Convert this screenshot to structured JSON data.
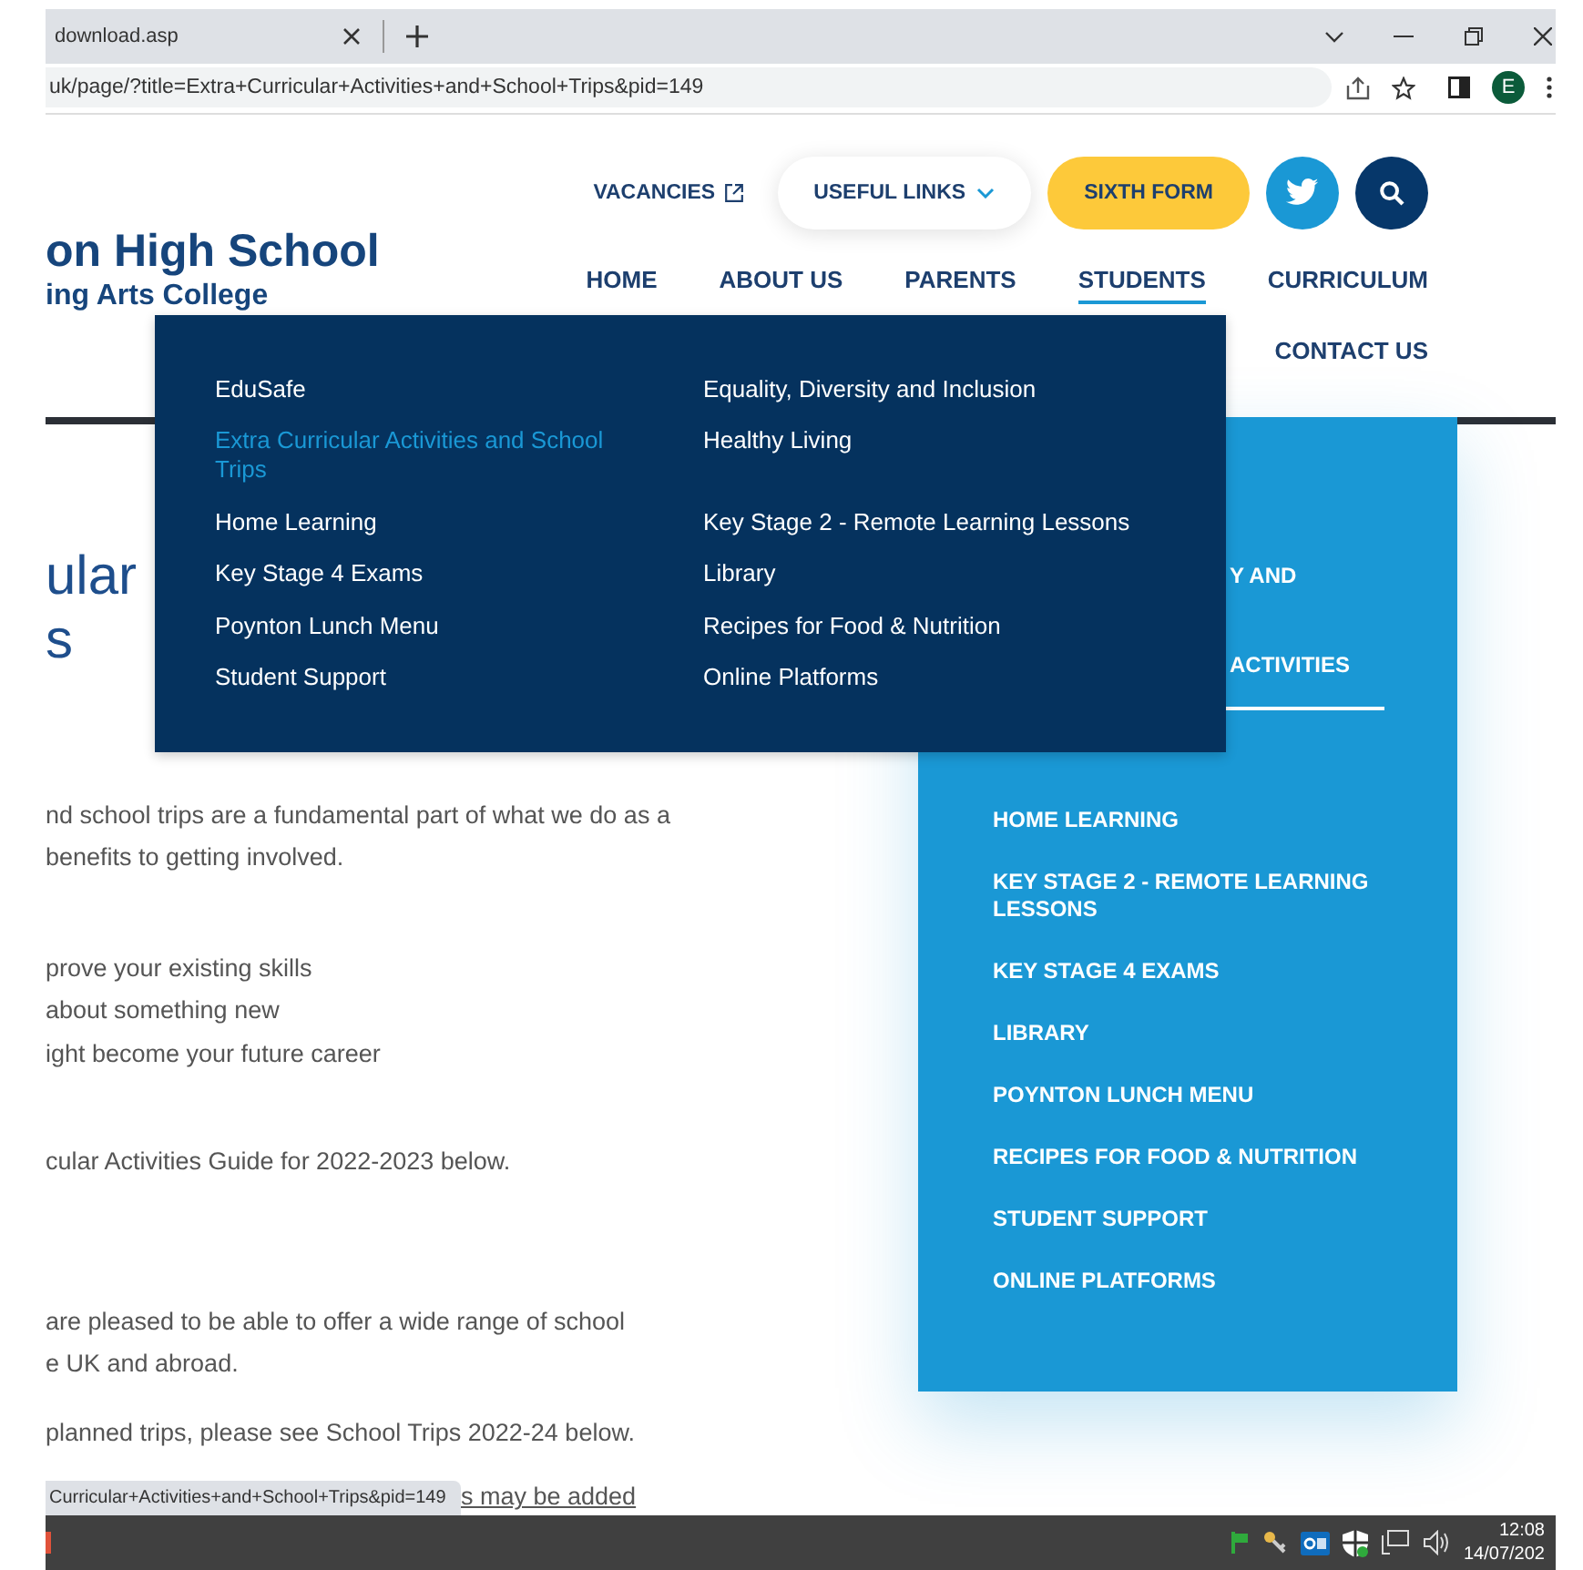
{
  "browser": {
    "tab_title": "download.asp",
    "address": "uk/page/?title=Extra+Curricular+Activities+and+School+Trips&pid=149",
    "profile_initial": "E"
  },
  "header": {
    "logo_line1": "on High School",
    "logo_line2": "ing Arts College",
    "vacancies": "VACANCIES",
    "useful_links": "USEFUL LINKS",
    "sixth_form": "SIXTH FORM",
    "nav": [
      {
        "label": "HOME",
        "selected": false
      },
      {
        "label": "ABOUT US",
        "selected": false
      },
      {
        "label": "PARENTS",
        "selected": false
      },
      {
        "label": "STUDENTS",
        "selected": true
      },
      {
        "label": "CURRICULUM",
        "selected": false
      },
      {
        "label": "CONTACT US",
        "selected": false
      }
    ]
  },
  "dropdown": {
    "left": [
      {
        "label": "EduSafe",
        "selected": false
      },
      {
        "label": "Extra Curricular Activities and School Trips",
        "selected": true
      },
      {
        "label": "Home Learning",
        "selected": false
      },
      {
        "label": "Key Stage 4 Exams",
        "selected": false
      },
      {
        "label": "Poynton Lunch Menu",
        "selected": false
      },
      {
        "label": "Student Support",
        "selected": false
      }
    ],
    "right": [
      {
        "label": "Equality, Diversity and Inclusion",
        "selected": false
      },
      {
        "label": "Healthy Living",
        "selected": false
      },
      {
        "label": "Key Stage 2 - Remote Learning Lessons",
        "selected": false
      },
      {
        "label": "Library",
        "selected": false
      },
      {
        "label": "Recipes for Food & Nutrition",
        "selected": false
      },
      {
        "label": "Online Platforms",
        "selected": false
      }
    ]
  },
  "sidebar": {
    "items": [
      {
        "label": "Y AND",
        "kind": "covered",
        "selected": false
      },
      {
        "label": "ACTIVITIES",
        "kind": "covered",
        "selected": true
      },
      {
        "label": "HOME LEARNING",
        "kind": "full",
        "selected": false
      },
      {
        "label": "KEY STAGE 2 - REMOTE LEARNING LESSONS",
        "kind": "full",
        "selected": false
      },
      {
        "label": "KEY STAGE 4 EXAMS",
        "kind": "full",
        "selected": false
      },
      {
        "label": "LIBRARY",
        "kind": "full",
        "selected": false
      },
      {
        "label": "POYNTON LUNCH MENU",
        "kind": "full",
        "selected": false
      },
      {
        "label": "RECIPES FOR FOOD & NUTRITION",
        "kind": "full",
        "selected": false
      },
      {
        "label": "STUDENT SUPPORT",
        "kind": "full",
        "selected": false
      },
      {
        "label": "ONLINE PLATFORMS",
        "kind": "full",
        "selected": false
      }
    ]
  },
  "content": {
    "heading": [
      "ular",
      "s"
    ],
    "paragraphs": [
      [
        "nd school trips are a fundamental part of what we do as a",
        "benefits to getting involved."
      ],
      [
        "prove your existing skills",
        "about something new",
        "ight become your future career"
      ],
      [
        "cular Activities Guide for 2022-2023 below."
      ],
      [
        "are pleased to be able to offer a wide range of school",
        "e UK and abroad."
      ],
      [
        "planned trips, please see School Trips 2022-24  below."
      ]
    ],
    "link": "s may be added"
  },
  "status_tooltip": "Curricular+Activities+and+School+Trips&pid=149",
  "taskbar": {
    "time": "12:08",
    "date": "14/07/202"
  }
}
